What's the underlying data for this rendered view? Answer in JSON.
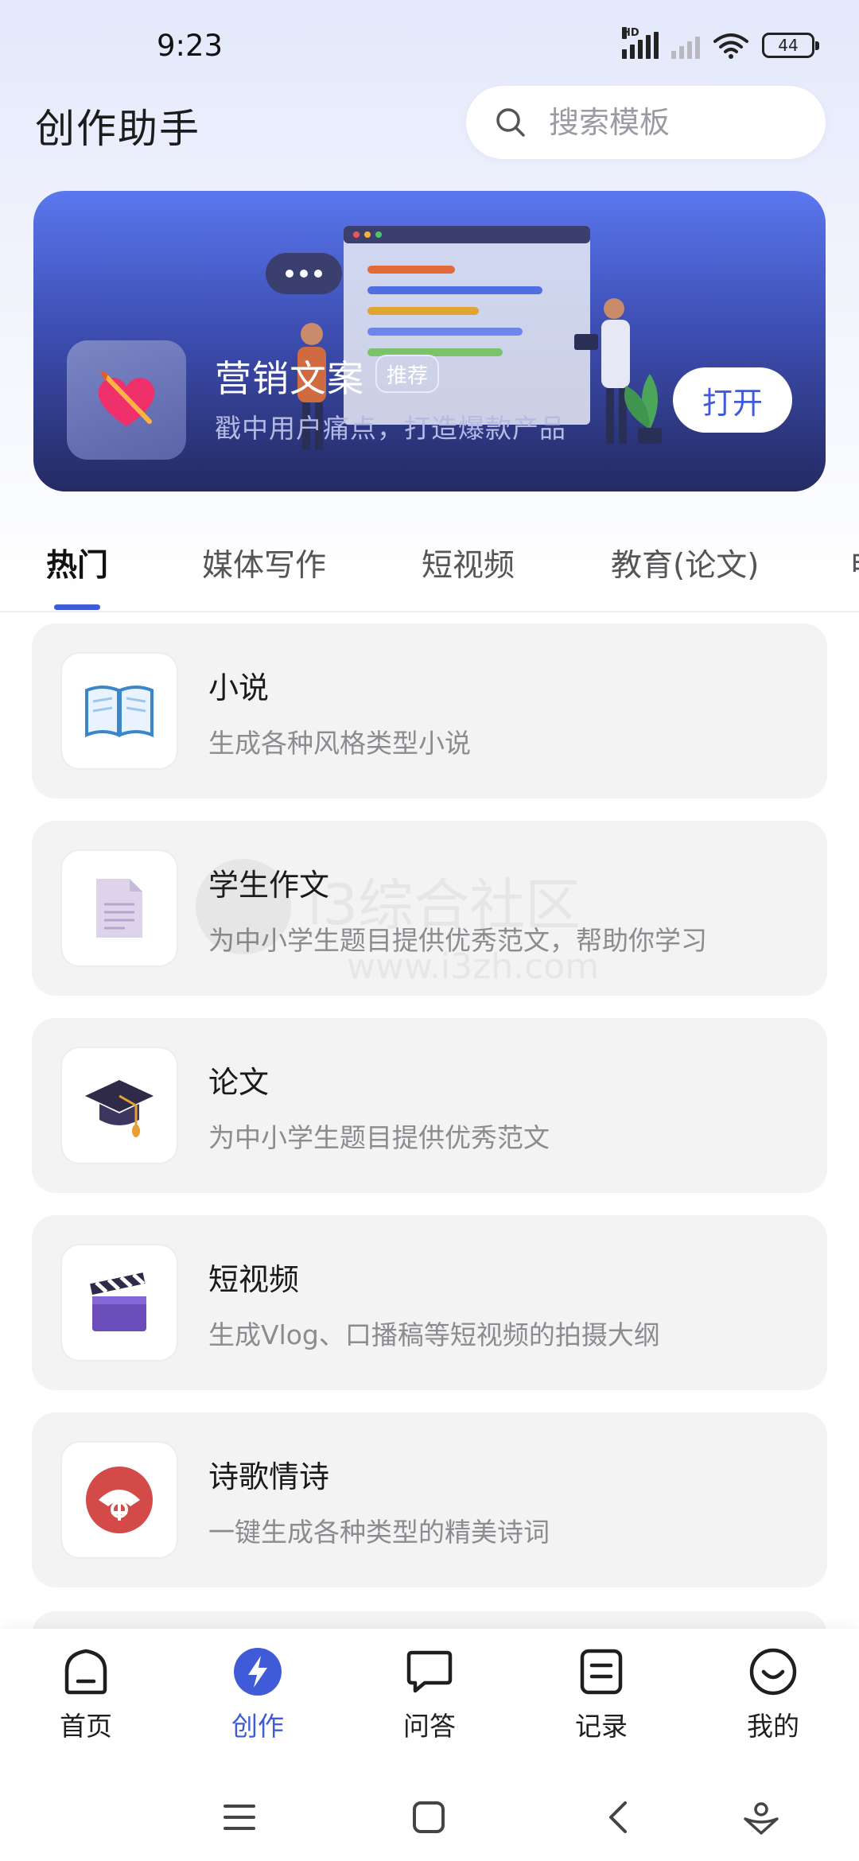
{
  "status_bar": {
    "time": "9:23",
    "signal_label": "HD",
    "battery": "44"
  },
  "header": {
    "title": "创作助手"
  },
  "search": {
    "placeholder": "搜索模板"
  },
  "banner": {
    "title": "营销文案",
    "badge": "推荐",
    "subtitle": "戳中用户痛点，打造爆款产品",
    "open_label": "打开",
    "gradient_top": "#5a77ee",
    "gradient_bottom": "#242a63"
  },
  "tabs": [
    {
      "label": "热门",
      "active": true
    },
    {
      "label": "媒体写作",
      "active": false
    },
    {
      "label": "短视频",
      "active": false
    },
    {
      "label": "教育(论文)",
      "active": false
    },
    {
      "label": "电",
      "active": false
    }
  ],
  "templates": [
    {
      "title": "小说",
      "description": "生成各种风格类型小说",
      "icon": "open-book-icon"
    },
    {
      "title": "学生作文",
      "description": "为中小学生题目提供优秀范文，帮助你学习",
      "icon": "document-icon"
    },
    {
      "title": "论文",
      "description": "为中小学生题目提供优秀范文",
      "icon": "graduation-cap-icon"
    },
    {
      "title": "短视频",
      "description": "生成Vlog、口播稿等短视频的拍摄大纲",
      "icon": "clapperboard-icon"
    },
    {
      "title": "诗歌情诗",
      "description": "一键生成各种类型的精美诗词",
      "icon": "folding-fan-icon"
    }
  ],
  "watermark": {
    "line1": "i3综合社区",
    "line2": "www.i3zh.com"
  },
  "bottom_nav": [
    {
      "label": "首页",
      "icon": "home-icon",
      "active": false
    },
    {
      "label": "创作",
      "icon": "lightning-icon",
      "active": true
    },
    {
      "label": "问答",
      "icon": "chat-bubble-icon",
      "active": false
    },
    {
      "label": "记录",
      "icon": "record-icon",
      "active": false
    },
    {
      "label": "我的",
      "icon": "smiley-icon",
      "active": false
    }
  ],
  "colors": {
    "accent": "#3f5bd7",
    "card_bg": "#f3f3f4",
    "text_secondary": "#8b8b90"
  }
}
